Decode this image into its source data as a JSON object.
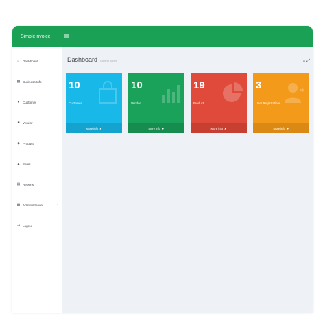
{
  "header": {
    "brand": "SimpleInvoice",
    "menu_icon": "hamburger-icon"
  },
  "sidebar": {
    "items": [
      {
        "label": "Dashboard",
        "icon": "home-icon",
        "has_submenu": false
      },
      {
        "label": "Business Info",
        "icon": "building-icon",
        "has_submenu": false
      },
      {
        "label": "Customer",
        "icon": "users-icon",
        "has_submenu": false
      },
      {
        "label": "Vendor",
        "icon": "truck-icon",
        "has_submenu": false
      },
      {
        "label": "Product",
        "icon": "tag-icon",
        "has_submenu": false
      },
      {
        "label": "Sales",
        "icon": "cart-icon",
        "has_submenu": false
      },
      {
        "label": "Reports",
        "icon": "report-icon",
        "has_submenu": true
      },
      {
        "label": "Administration",
        "icon": "admin-icon",
        "has_submenu": true
      },
      {
        "label": "Logout",
        "icon": "logout-icon",
        "has_submenu": false
      }
    ]
  },
  "page": {
    "title": "Dashboard",
    "subtitle": "Control panel"
  },
  "stats": [
    {
      "value": "10",
      "label": "Customer",
      "footer": "More info",
      "color": "#18b8e8",
      "footer_color": "#14a3ce",
      "icon": "shopping-bag-icon"
    },
    {
      "value": "10",
      "label": "Vendor",
      "footer": "More info",
      "color": "#1aa25a",
      "footer_color": "#168d4e",
      "icon": "bar-chart-icon"
    },
    {
      "value": "19",
      "label": "Product",
      "footer": "More info",
      "color": "#e04a3a",
      "footer_color": "#c63f31",
      "icon": "pie-chart-icon"
    },
    {
      "value": "3",
      "label": "User Registrations",
      "footer": "More info",
      "color": "#f39a1b",
      "footer_color": "#d98914",
      "icon": "user-add-icon"
    }
  ],
  "colors": {
    "header": "#1aa156",
    "content_bg": "#eef1f6",
    "sidebar_bg": "#ffffff"
  }
}
